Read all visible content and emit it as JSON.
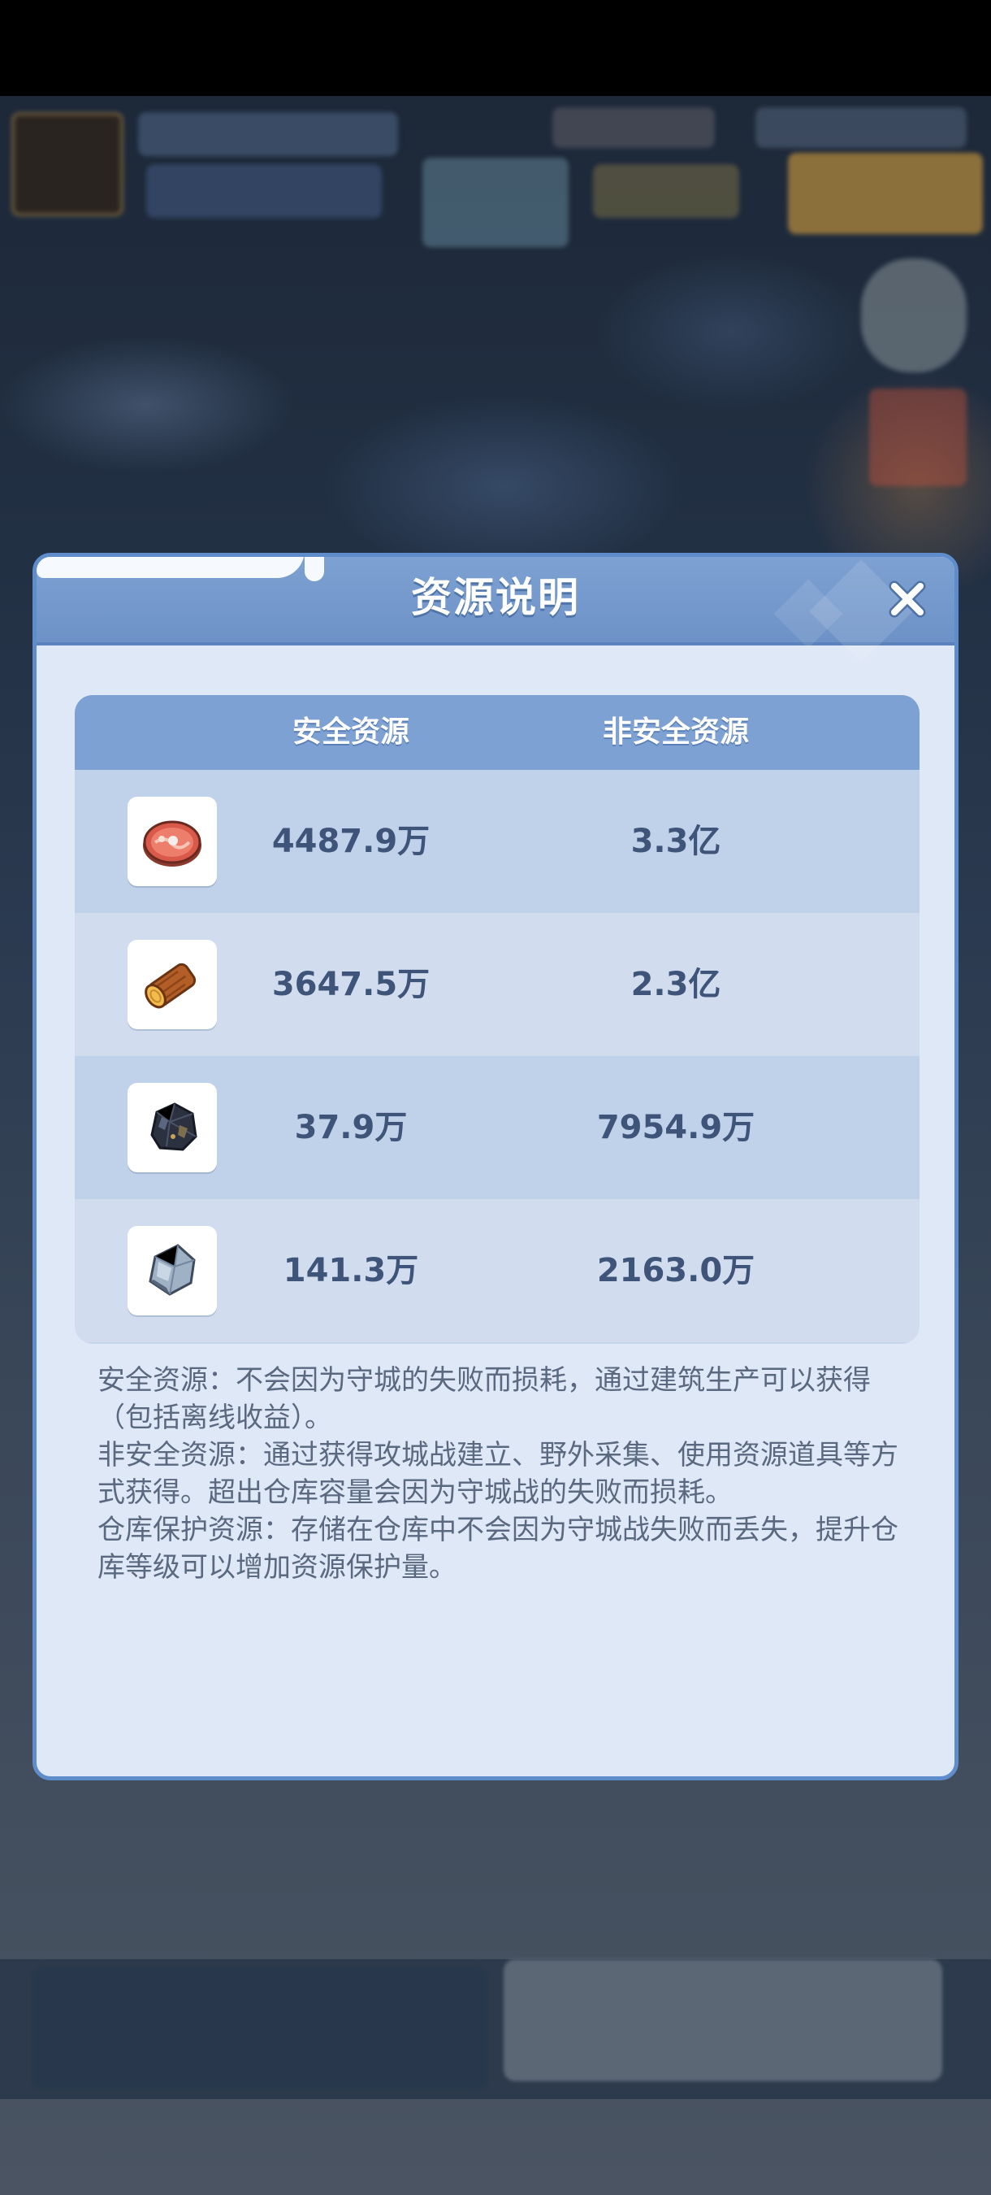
{
  "dialog": {
    "title": "资源说明",
    "close_icon": "close-icon"
  },
  "table": {
    "headers": {
      "safe": "安全资源",
      "unsafe": "非安全资源"
    },
    "rows": [
      {
        "icon": "meat-icon",
        "safe": "4487.9万",
        "unsafe": "3.3亿"
      },
      {
        "icon": "wood-log-icon",
        "safe": "3647.5万",
        "unsafe": "2.3亿"
      },
      {
        "icon": "coal-icon",
        "safe": "37.9万",
        "unsafe": "7954.9万"
      },
      {
        "icon": "iron-ore-icon",
        "safe": "141.3万",
        "unsafe": "2163.0万"
      }
    ]
  },
  "description": {
    "safe": "安全资源：不会因为守城的失败而损耗，通过建筑生产可以获得（包括离线收益）。",
    "unsafe": "非安全资源：通过获得攻城战建立、野外采集、使用资源道具等方式获得。超出仓库容量会因为守城战的失败而损耗。",
    "protected": "仓库保护资源：存储在仓库中不会因为守城战失败而丢失，提升仓库等级可以增加资源保护量。"
  },
  "colors": {
    "header_blue": "#7ea1d3",
    "dialog_bg": "#dfe8f6",
    "value_text": "#3f5479"
  }
}
